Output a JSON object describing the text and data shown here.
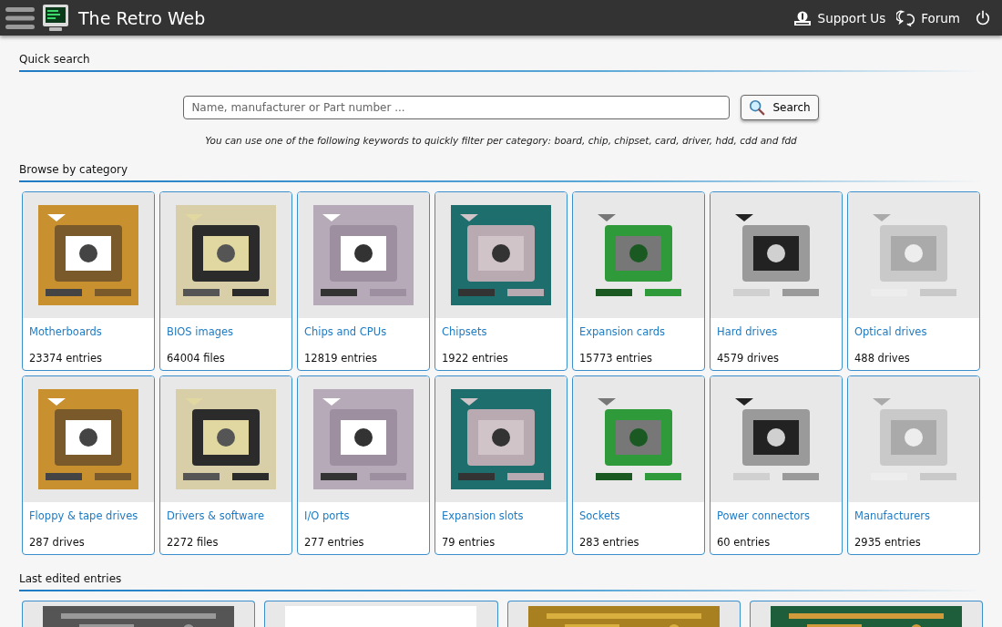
{
  "header": {
    "title": "The Retro Web",
    "links": [
      {
        "label": "Support Us",
        "kind": "support"
      },
      {
        "label": "Forum",
        "kind": "forum"
      }
    ]
  },
  "quick_search": {
    "heading": "Quick search",
    "placeholder": "Name, manufacturer or Part number ...",
    "button": "Search",
    "hint": "You can use one of the following keywords to quickly filter per category: board, chip, chipset, card, driver, hdd, cdd and fdd"
  },
  "browse": {
    "heading": "Browse by category",
    "categories": [
      {
        "name": "Motherboards",
        "count": "23374 entries"
      },
      {
        "name": "BIOS images",
        "count": "64004 files"
      },
      {
        "name": "Chips and CPUs",
        "count": "12819 entries"
      },
      {
        "name": "Chipsets",
        "count": "1922 entries"
      },
      {
        "name": "Expansion cards",
        "count": "15773 entries"
      },
      {
        "name": "Hard drives",
        "count": "4579 drives"
      },
      {
        "name": "Optical drives",
        "count": "488 drives"
      },
      {
        "name": "Floppy & tape drives",
        "count": "287 drives"
      },
      {
        "name": "Drivers & software",
        "count": "2272 files"
      },
      {
        "name": "I/O ports",
        "count": "277 entries"
      },
      {
        "name": "Expansion slots",
        "count": "79 entries"
      },
      {
        "name": "Sockets",
        "count": "283 entries"
      },
      {
        "name": "Power connectors",
        "count": "60 entries"
      },
      {
        "name": "Manufacturers",
        "count": "2935 entries"
      }
    ]
  },
  "last_edited": {
    "heading": "Last edited entries"
  }
}
